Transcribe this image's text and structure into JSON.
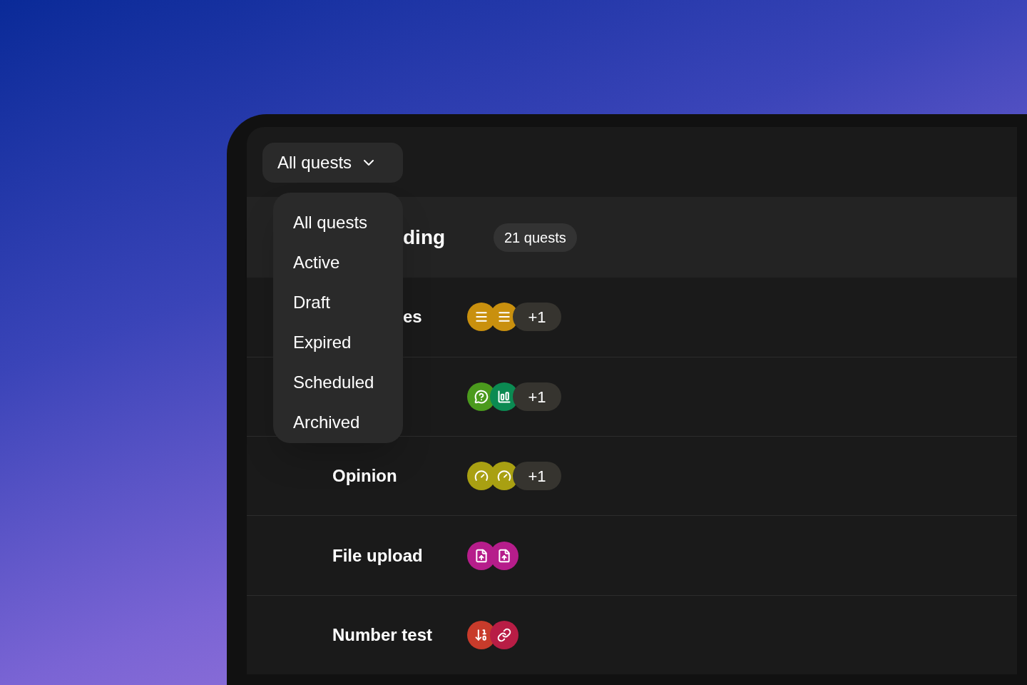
{
  "filter_button": {
    "label": "All quests"
  },
  "dropdown": {
    "items": [
      {
        "label": "All quests"
      },
      {
        "label": "Active"
      },
      {
        "label": "Draft"
      },
      {
        "label": "Expired"
      },
      {
        "label": "Scheduled"
      },
      {
        "label": "Archived"
      }
    ]
  },
  "heading": {
    "title": "ding",
    "count": "21 quests"
  },
  "categories": [
    {
      "name": "es",
      "icons": [
        {
          "kind": "lines",
          "color": "#c9900e"
        },
        {
          "kind": "lines",
          "color": "#c9900e"
        }
      ],
      "more": "+1"
    },
    {
      "icons": [
        {
          "kind": "question",
          "color": "#4b9a1d"
        },
        {
          "kind": "chart",
          "color": "#0b8a52"
        }
      ],
      "more": "+1"
    },
    {
      "name": "Opinion",
      "icons": [
        {
          "kind": "gauge",
          "color": "#a9a012"
        },
        {
          "kind": "gauge",
          "color": "#a9a012"
        }
      ],
      "more": "+1"
    },
    {
      "name": "File upload",
      "icons": [
        {
          "kind": "file",
          "color": "#b61d8b"
        },
        {
          "kind": "file",
          "color": "#b61d8b"
        }
      ]
    },
    {
      "name": "Number test",
      "icons": [
        {
          "kind": "sort",
          "color": "#c83b2b"
        },
        {
          "kind": "link",
          "color": "#b81d45"
        }
      ]
    }
  ]
}
